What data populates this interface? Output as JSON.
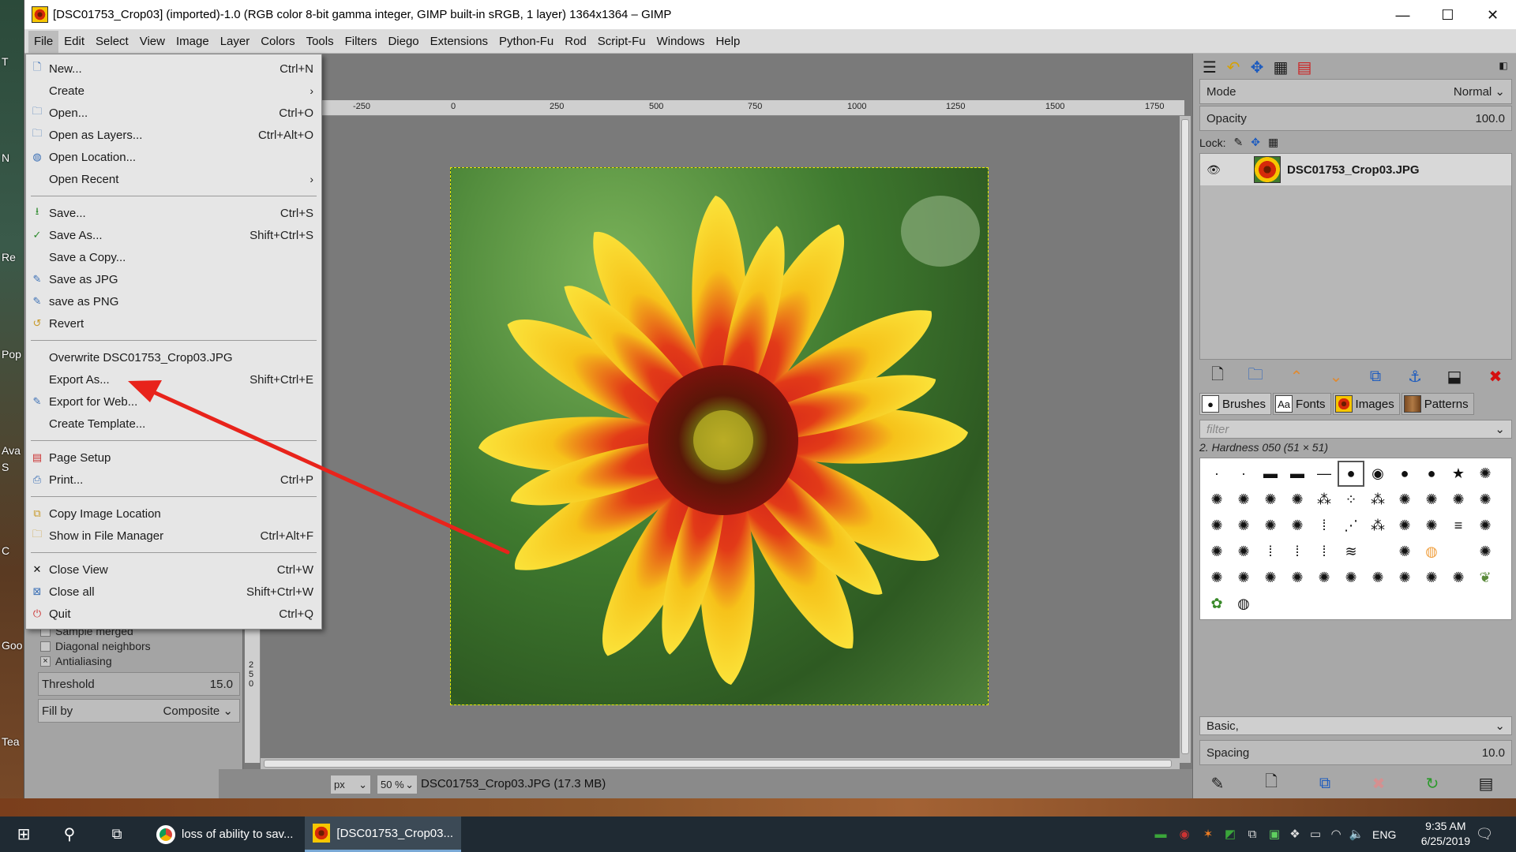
{
  "window": {
    "title": "[DSC01753_Crop03] (imported)-1.0 (RGB color 8-bit gamma integer, GIMP built-in sRGB, 1 layer) 1364x1364 – GIMP",
    "controls": [
      "minimize-icon",
      "maximize-icon",
      "close-icon"
    ]
  },
  "menubar": [
    "File",
    "Edit",
    "Select",
    "View",
    "Image",
    "Layer",
    "Colors",
    "Tools",
    "Filters",
    "Diego",
    "Extensions",
    "Python-Fu",
    "Rod",
    "Script-Fu",
    "Windows",
    "Help"
  ],
  "file_menu": {
    "items": [
      {
        "label": "New...",
        "shortcut": "Ctrl+N",
        "icon": "new-icon"
      },
      {
        "label": "Create",
        "submenu": true
      },
      {
        "label": "Open...",
        "shortcut": "Ctrl+O",
        "icon": "open-icon"
      },
      {
        "label": "Open as Layers...",
        "shortcut": "Ctrl+Alt+O",
        "icon": "open-layers-icon"
      },
      {
        "label": "Open Location...",
        "icon": "globe-icon"
      },
      {
        "label": "Open Recent",
        "submenu": true
      },
      {
        "sep": true
      },
      {
        "label": "Save...",
        "shortcut": "Ctrl+S",
        "icon": "save-icon"
      },
      {
        "label": "Save As...",
        "shortcut": "Shift+Ctrl+S",
        "icon": "save-as-icon"
      },
      {
        "label": "Save a Copy..."
      },
      {
        "label": "Save as JPG",
        "icon": "script-icon"
      },
      {
        "label": "save as PNG",
        "icon": "script-icon"
      },
      {
        "label": "Revert",
        "icon": "revert-icon"
      },
      {
        "sep": true
      },
      {
        "label": "Overwrite DSC01753_Crop03.JPG"
      },
      {
        "label": "Export As...",
        "shortcut": "Shift+Ctrl+E"
      },
      {
        "label": "Export for Web...",
        "icon": "script-icon"
      },
      {
        "label": "Create Template..."
      },
      {
        "sep": true
      },
      {
        "label": "Page Setup",
        "icon": "page-setup-icon"
      },
      {
        "label": "Print...",
        "shortcut": "Ctrl+P",
        "icon": "print-icon"
      },
      {
        "sep": true
      },
      {
        "label": "Copy Image Location",
        "icon": "copy-icon"
      },
      {
        "label": "Show in File Manager",
        "shortcut": "Ctrl+Alt+F",
        "icon": "folder-icon"
      },
      {
        "sep": true
      },
      {
        "label": "Close View",
        "shortcut": "Ctrl+W",
        "icon": "close-view-icon"
      },
      {
        "label": "Close all",
        "shortcut": "Shift+Ctrl+W",
        "icon": "close-all-icon"
      },
      {
        "label": "Quit",
        "shortcut": "Ctrl+Q",
        "icon": "quit-icon"
      }
    ]
  },
  "tool_options": {
    "sample_merged": "Sample merged",
    "diagonal_neighbors": "Diagonal neighbors",
    "antialiasing": "Antialiasing",
    "antialiasing_checked": "×",
    "threshold_label": "Threshold",
    "threshold_value": "15.0",
    "fill_by_label": "Fill by",
    "fill_by_value": "Composite"
  },
  "ruler": {
    "ticks": [
      "-250",
      "0",
      "250",
      "500",
      "750",
      "1000",
      "1250",
      "1500",
      "1750"
    ]
  },
  "ruler_left_ticks": [
    "2",
    "5",
    "0"
  ],
  "statusbar": {
    "unit": "px",
    "zoom": "50 %",
    "text": "DSC01753_Crop03.JPG (17.3 MB)"
  },
  "layers_panel": {
    "mode_label": "Mode",
    "mode_value": "Normal",
    "opacity_label": "Opacity",
    "opacity_value": "100.0",
    "lock_label": "Lock:",
    "layer_name": "DSC01753_Crop03.JPG"
  },
  "brushes_panel": {
    "tabs": [
      {
        "label": "Brushes",
        "icon": "brushes-icon"
      },
      {
        "label": "Fonts",
        "icon": "fonts-icon",
        "glyph": "Aa"
      },
      {
        "label": "Images",
        "icon": "images-icon"
      },
      {
        "label": "Patterns",
        "icon": "patterns-icon"
      }
    ],
    "filter_placeholder": "filter",
    "selected_brush": "2. Hardness 050 (51 × 51)",
    "preset": "Basic,",
    "spacing_label": "Spacing",
    "spacing_value": "10.0"
  },
  "desktop_labels": [
    "T",
    "N",
    "Re",
    "Pop",
    "Ava",
    "S",
    "C",
    "Goo",
    "Tea"
  ],
  "taskbar": {
    "apps": [
      {
        "label": "loss of ability to sav...",
        "icon": "chrome-icon"
      },
      {
        "label": "[DSC01753_Crop03...",
        "icon": "gimp-icon",
        "active": true
      }
    ],
    "language": "ENG",
    "time": "9:35 AM",
    "date": "6/25/2019"
  },
  "colors": {
    "annotation_arrow": "#e8231b",
    "menu_bg": "#e6e6e6",
    "canvas_bg": "#7a7a7a"
  }
}
